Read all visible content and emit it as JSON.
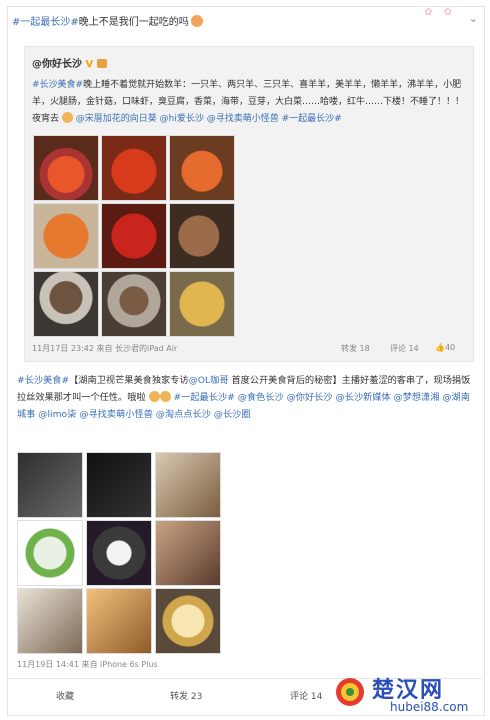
{
  "post1": {
    "tag": "#一起最长沙#",
    "text": "晚上不是我们一起吃的吗",
    "inner": {
      "author": "@你好长沙",
      "tag": "#长沙美食#",
      "text_a": "晚上睡不着觉就开始数羊：一只羊、两只羊、三只羊、喜羊羊，美羊羊，懒羊羊，沸羊羊，小肥羊，火腿肠，金针菇，口味虾，臭豆腐，香菜，海带，豆芽，大白菜……哈喽，红牛……下楼！不睡了！！！夜宵去",
      "mentions": [
        "@宋厝加花的向日葵",
        "@hi爱长沙",
        "@寻找卖萌小怪兽",
        "#一起最长沙#"
      ],
      "time": "11月17日 23:42 来自 长沙君的iPad Air",
      "repost": "转发 18",
      "comment": "评论 14",
      "like": "40"
    }
  },
  "post2": {
    "tag": "#长沙美食#",
    "title": "【湖南卫视芒果美食独家专访",
    "mention1": "@OL咖哥",
    "title_b": "首度公开美食背后的秘密】主播好羞涩的客串了，现场捐饭拉丝效果那才叫一个任性。哦啦",
    "links": [
      "#一起最长沙#",
      "@食色长沙",
      "@你好长沙",
      "@长沙新媒体",
      "@梦想潇湘",
      "@湖南城事",
      "@limo柒",
      "@寻找卖萌小怪兽",
      "@淘点点长沙",
      "@长沙圈"
    ],
    "time": "11月19日 14:41 来自 iPhone 6s Plus"
  },
  "bar": {
    "collect": "收藏",
    "repost": "转发 23",
    "comment": "评论 14"
  },
  "logo": {
    "name": "楚汉网",
    "url": "hubei88.com"
  },
  "colors": {
    "link": "#3b6fb6",
    "logo": "#2a4fb8"
  }
}
